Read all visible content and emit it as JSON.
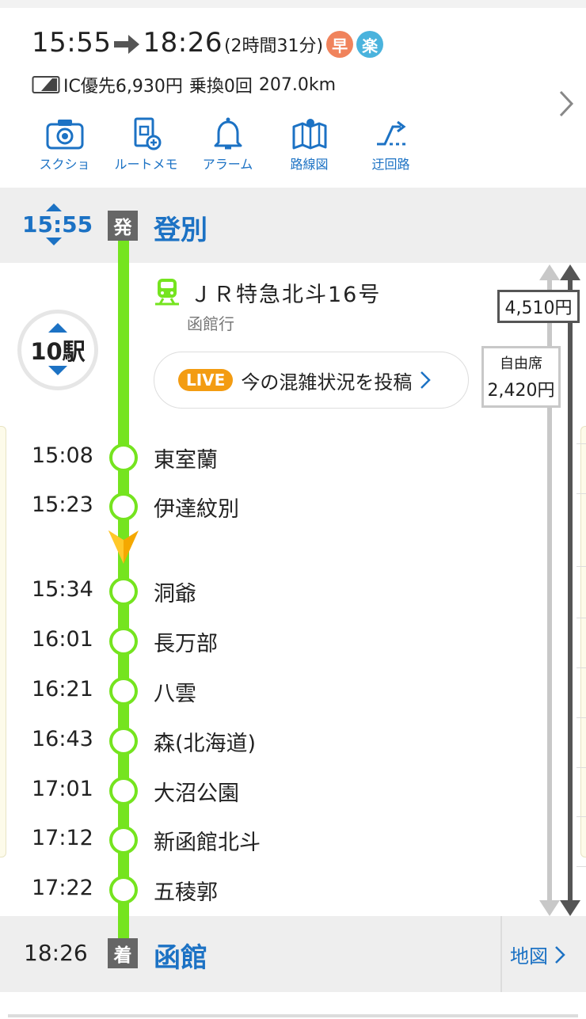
{
  "summary": {
    "depart": "15:55",
    "arrive": "18:26",
    "duration": "(2時間31分)",
    "badge_fast": "早",
    "badge_easy": "楽",
    "fare_text": "IC優先6,930円",
    "transfers": "乗換0回",
    "distance": "207.0km"
  },
  "actions": [
    {
      "label": "スクショ",
      "icon": "camera-icon"
    },
    {
      "label": "ルートメモ",
      "icon": "route-memo-icon"
    },
    {
      "label": "アラーム",
      "icon": "bell-icon"
    },
    {
      "label": "路線図",
      "icon": "map-icon"
    },
    {
      "label": "迂回路",
      "icon": "detour-icon"
    }
  ],
  "departure": {
    "time": "15:55",
    "mark": "発",
    "station": "登別"
  },
  "train": {
    "name": "ＪＲ特急北斗16号",
    "destination": "函館行",
    "stop_count": "10駅",
    "live_tag": "LIVE",
    "live_text": "今の混雑状況を投稿"
  },
  "fares": {
    "base_fare": "4,510円",
    "seat_type": "自由席",
    "seat_fare": "2,420円"
  },
  "stops": [
    {
      "time": "15:08",
      "name": "東室蘭"
    },
    {
      "time": "15:23",
      "name": "伊達紋別"
    },
    {
      "time": "15:34",
      "name": "洞爺"
    },
    {
      "time": "16:01",
      "name": "長万部"
    },
    {
      "time": "16:21",
      "name": "八雲"
    },
    {
      "time": "16:43",
      "name": "森(北海道)"
    },
    {
      "time": "17:01",
      "name": "大沼公園"
    },
    {
      "time": "17:12",
      "name": "新函館北斗"
    },
    {
      "time": "17:22",
      "name": "五稜郭"
    }
  ],
  "arrival": {
    "time": "18:26",
    "mark": "着",
    "station": "函館",
    "map_label": "地図"
  },
  "colors": {
    "accent_blue": "#1c72c4",
    "route_green": "#75e41f",
    "live_orange": "#f39c12"
  }
}
